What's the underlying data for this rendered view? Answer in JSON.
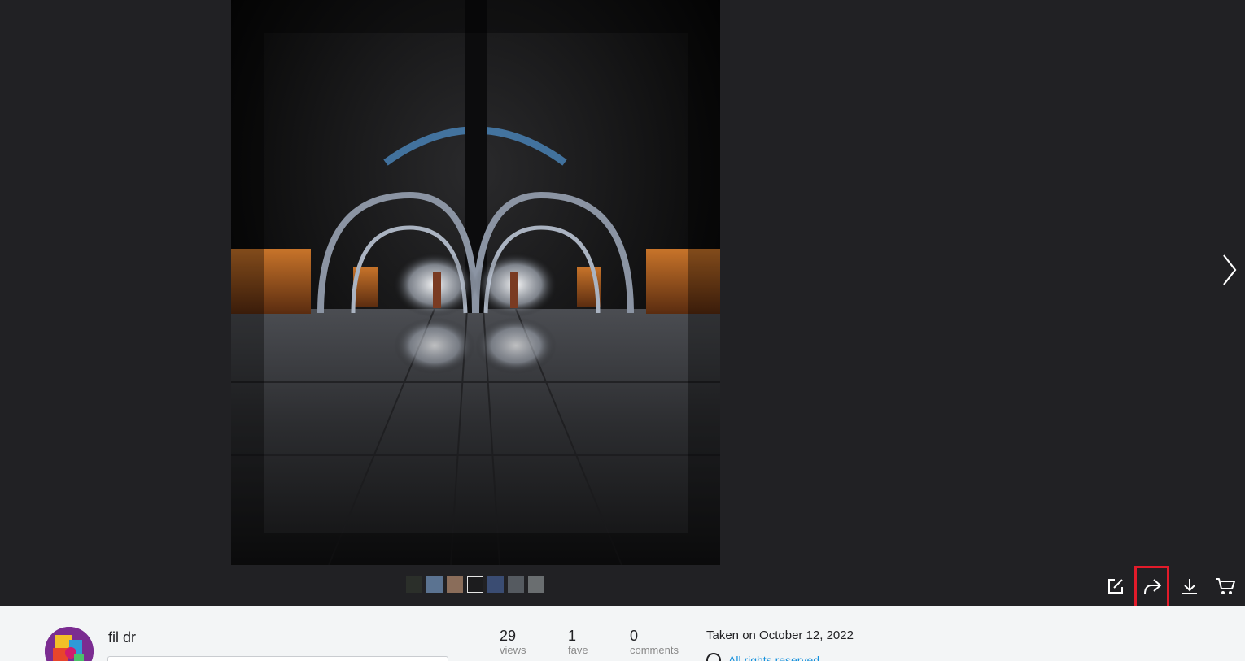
{
  "viewer": {
    "filmstrip": [
      {
        "name": "thumb-1",
        "color": "#2b2f2a",
        "active": false
      },
      {
        "name": "thumb-2",
        "color": "#5b7391",
        "active": false
      },
      {
        "name": "thumb-3",
        "color": "#8a6d5a",
        "active": false
      },
      {
        "name": "thumb-4",
        "color": "#1c1c1e",
        "active": true
      },
      {
        "name": "thumb-5",
        "color": "#3a4c72",
        "active": false
      },
      {
        "name": "thumb-6",
        "color": "#555a60",
        "active": false
      },
      {
        "name": "thumb-7",
        "color": "#6a6e70",
        "active": false
      }
    ],
    "actions": [
      {
        "name": "edit-icon"
      },
      {
        "name": "share-icon"
      },
      {
        "name": "download-icon"
      },
      {
        "name": "cart-icon"
      }
    ]
  },
  "info": {
    "username": "fil dr",
    "stats": [
      {
        "value": "29",
        "label": "views"
      },
      {
        "value": "1",
        "label": "fave"
      },
      {
        "value": "0",
        "label": "comments"
      }
    ],
    "taken": "Taken on October 12, 2022",
    "rights": "All rights reserved"
  },
  "colors": {
    "viewer_bg": "#212124",
    "info_bg": "#f3f5f6",
    "highlight": "#e21b2a",
    "link": "#128fdc"
  }
}
